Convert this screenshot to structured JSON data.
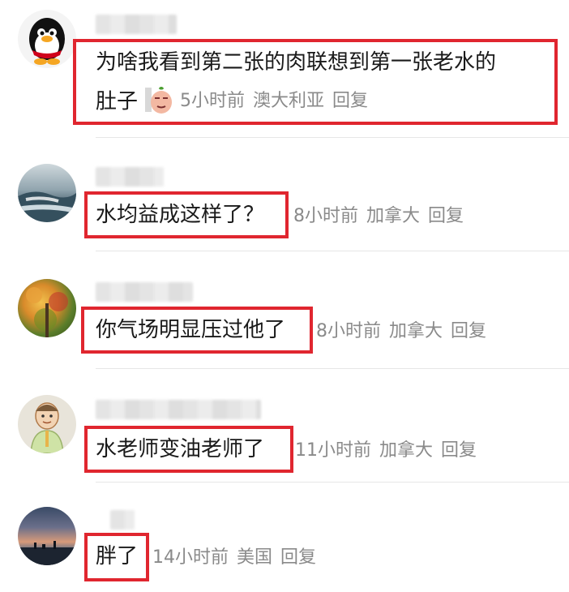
{
  "comments": [
    {
      "text_line1": "为啥我看到第二张的肉联想到第一张老水的",
      "text_line2": "肚子",
      "emoji": "face-emoji",
      "time": "5小时前",
      "location": "澳大利亚",
      "reply": "回复",
      "avatar": "penguin-avatar"
    },
    {
      "text": "水均益成这样了？",
      "time": "8小时前",
      "location": "加拿大",
      "reply": "回复",
      "avatar": "waterfall-avatar"
    },
    {
      "text": "你气场明显压过他了",
      "time": "8小时前",
      "location": "加拿大",
      "reply": "回复",
      "avatar": "autumn-tree-avatar"
    },
    {
      "text": "水老师变油老师了",
      "time": "11小时前",
      "location": "加拿大",
      "reply": "回复",
      "avatar": "drawing-avatar"
    },
    {
      "text": "胖了",
      "time": "14小时前",
      "location": "美国",
      "reply": "回复",
      "avatar": "sunset-avatar"
    }
  ],
  "colors": {
    "highlight_box": "#e0262f",
    "meta_text": "#8a8a8a",
    "body_text": "#1a1a1a"
  }
}
